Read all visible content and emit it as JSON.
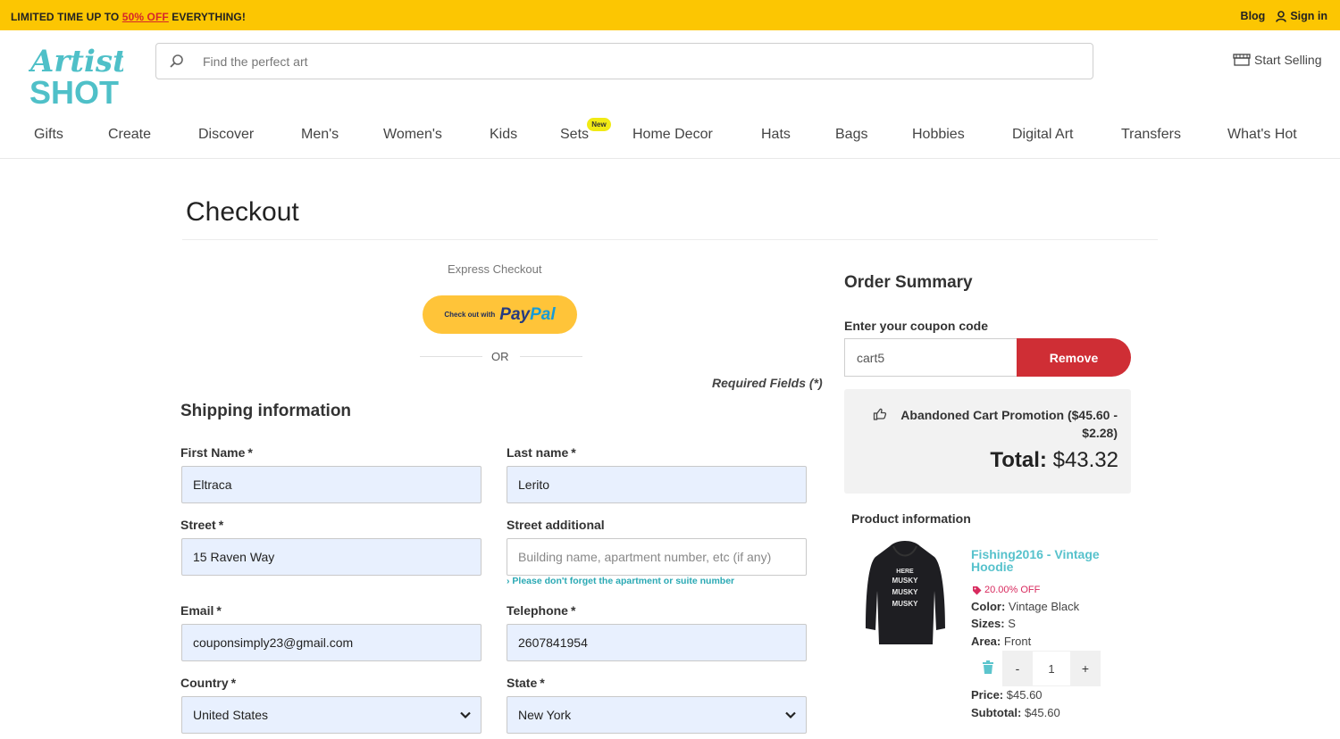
{
  "promo": {
    "prefix": "LIMITED TIME UP TO ",
    "highlight": "50% OFF",
    "suffix": " EVERYTHING!",
    "blog": "Blog",
    "signin": "Sign in"
  },
  "header": {
    "logo_text_top": "Artist",
    "logo_text_bottom": "SHOT",
    "search_placeholder": "Find the perfect art",
    "start_selling": "Start Selling"
  },
  "nav": {
    "items": [
      "Gifts",
      "Create",
      "Discover",
      "Men's",
      "Women's",
      "Kids",
      "Sets",
      "Home Decor",
      "Hats",
      "Bags",
      "Hobbies",
      "Digital Art",
      "Transfers",
      "What's Hot"
    ],
    "new_badge": "New"
  },
  "checkout": {
    "title": "Checkout",
    "express_label": "Express Checkout",
    "paypal_small": "Check out with",
    "paypal_pay": "Pay",
    "paypal_pal": "Pal",
    "or": "OR",
    "required_fields": "Required Fields (*)"
  },
  "shipping": {
    "title": "Shipping information",
    "first_name": {
      "label": "First Name",
      "value": "Eltraca"
    },
    "last_name": {
      "label": "Last name",
      "value": "Lerito"
    },
    "street": {
      "label": "Street",
      "value": "15 Raven Way"
    },
    "street_additional": {
      "label": "Street additional",
      "placeholder": "Building name, apartment number, etc (if any)",
      "hint": "Please don't forget the apartment or suite number"
    },
    "email": {
      "label": "Email",
      "value": "couponsimply23@gmail.com"
    },
    "telephone": {
      "label": "Telephone",
      "value": "2607841954"
    },
    "country": {
      "label": "Country",
      "value": "United States"
    },
    "state": {
      "label": "State",
      "value": "New York"
    },
    "required_mark": "*"
  },
  "order_summary": {
    "title": "Order Summary",
    "coupon_label": "Enter your coupon code",
    "coupon_value": "cart5",
    "remove_label": "Remove",
    "promotion_line1": "Abandoned Cart Promotion ($45.60 -",
    "promotion_line2": "$2.28)",
    "total_label": "Total:",
    "total_value": "$43.32"
  },
  "product": {
    "section_title": "Product information",
    "name": "Fishing2016 - Vintage Hoodie",
    "discount": "20.00% OFF",
    "color_label": "Color:",
    "color_value": "Vintage Black",
    "sizes_label": "Sizes:",
    "sizes_value": "S",
    "area_label": "Area:",
    "area_value": "Front",
    "qty_minus": "-",
    "qty_value": "1",
    "qty_plus": "+",
    "price_label": "Price:",
    "price_value": "$45.60",
    "subtotal_label": "Subtotal:",
    "subtotal_value": "$45.60",
    "hoodie_print": [
      "HERE",
      "MUSKY",
      "MUSKY",
      "MUSKY"
    ]
  },
  "colors": {
    "promo_bar": "#fcc602",
    "accent_teal": "#57c2cc",
    "remove_red": "#cf2e35",
    "paypal_yellow": "#ffc439",
    "autofill_blue": "#e8f0fe"
  }
}
